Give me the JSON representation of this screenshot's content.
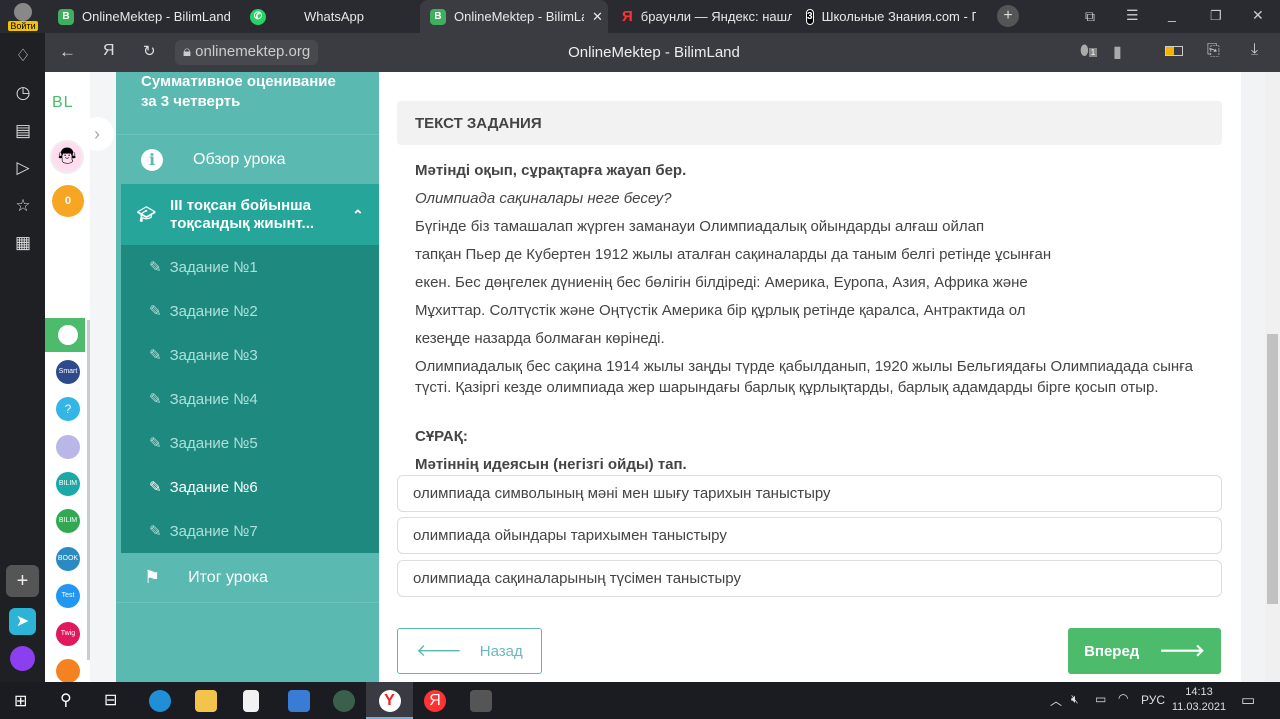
{
  "browser": {
    "login_label": "Войти",
    "tabs": [
      {
        "title": "OnlineMektep - BilimLand"
      },
      {
        "title": "WhatsApp"
      },
      {
        "title": "OnlineMektep - BilimLand"
      },
      {
        "title": "браунли — Яндекс: нашлось"
      },
      {
        "title": "Школьные Знания.com - Г"
      }
    ],
    "url": "onlinemektep.org",
    "page_title": "OnlineMektep - BilimLand",
    "tab_count_badge": "1"
  },
  "rail": {
    "logo": "BL",
    "points": "0"
  },
  "sidebar": {
    "title": "Суммативное оценивание за 3 четверть",
    "overview": "Обзор урока",
    "section": "III тоқсан бойынша тоқсандық жиынт...",
    "tasks": [
      "Задание №1",
      "Задание №2",
      "Задание №3",
      "Задание №4",
      "Задание №5",
      "Задание №6",
      "Задание №7"
    ],
    "current_task": 5,
    "summary": "Итог урока"
  },
  "main": {
    "header": "ТЕКСТ ЗАДАНИЯ",
    "instruction": "Мәтінді оқып, сұрақтарға жауап бер.",
    "subtitle": "Олимпиада сақиналары неге бесеу?",
    "lines": [
      "Бүгінде біз тамашалап жүрген заманауи Олимпиадалық ойындарды алғаш ойлап",
      "тапқан Пьер де Кубертен 1912 жылы аталған сақиналарды да таным белгі ретінде ұсынған",
      "екен. Бес дөңгелек дүниенің бес бөлігін білдіреді: Америка, Еуропа, Азия, Африка және",
      "Мұхиттар. Солтүстік және Оңтүстік Америка бір құрлық ретінде қаралса, Антрактида ол",
      "кезеңде назарда болмаған көрінеді."
    ],
    "paragraph": "Олимпиадалық бес сақина 1914 жылы заңды түрде қабылданып, 1920 жылы Бельгиядағы Олимпиадада сынға түсті. Қазіргі кезде олимпиада жер шарындағы барлық құрлықтарды, барлық адамдарды бірге қосып отыр.",
    "question_label": "СҰРАҚ:",
    "question": "Мәтіннің идеясын (негізгі ойды) тап.",
    "options": [
      "олимпиада символының мәні мен шығу тарихын таныстыру",
      "олимпиада ойындары тарихымен таныстыру",
      "олимпиада сақиналарының түсімен таныстыру"
    ],
    "back": "Назад",
    "next": "Вперед"
  },
  "taskbar": {
    "lang": "РУС",
    "time": "14:13",
    "date": "11.03.2021"
  },
  "colors": {
    "teal": "#5ab9b1",
    "teal_active": "#26a69a",
    "teal_dark": "#1e8a7f",
    "green": "#4cbb6c"
  }
}
